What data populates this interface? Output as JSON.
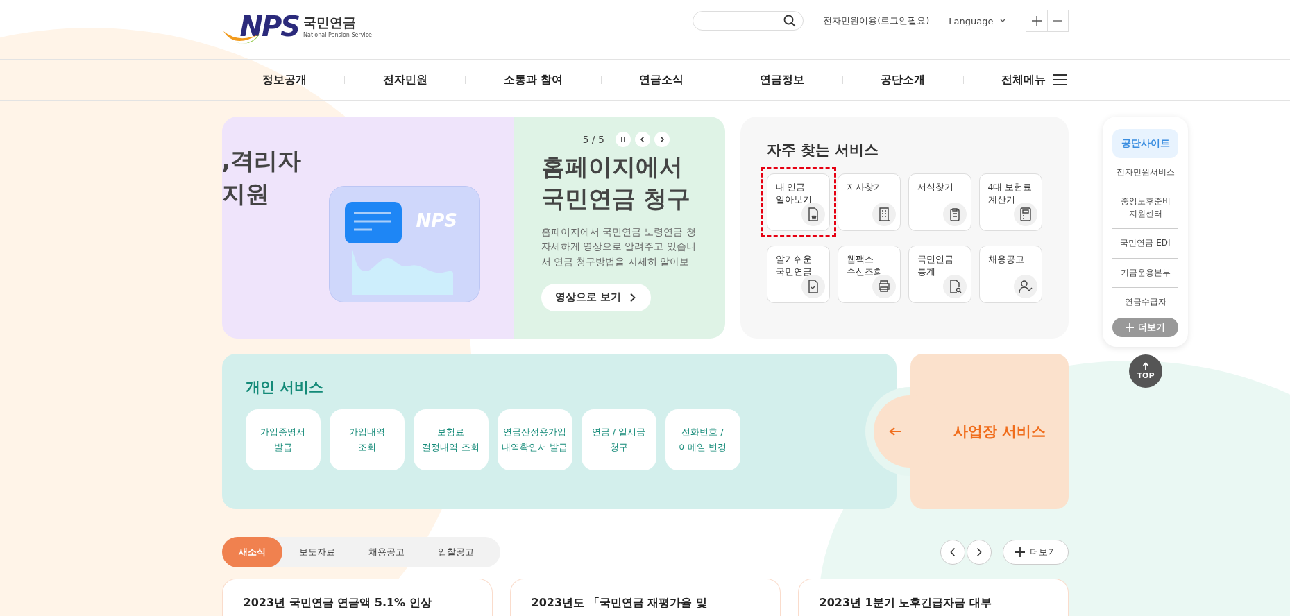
{
  "header": {
    "logo": {
      "mark": "NPS",
      "name": "국민연금",
      "subtitle": "National Pension Service"
    },
    "links": [
      {
        "label": "전자민원이용(로그인필요)",
        "kind": "link"
      },
      {
        "label": "Language",
        "kind": "dropdown"
      }
    ]
  },
  "nav": {
    "items": [
      "정보공개",
      "전자민원",
      "소통과 참여",
      "연금소식",
      "연금정보",
      "공단소개"
    ],
    "all_menu": "전체메뉴"
  },
  "banner": {
    "counter": "5 / 5",
    "playing": true,
    "previous_slide": {
      "heading_lines": [
        ",격리자",
        "지원"
      ],
      "illustration_logo": "NPS"
    },
    "current_slide": {
      "heading_lines": [
        "홈페이지에서",
        "국민연금 청구"
      ],
      "text_lines": [
        "홈페이지에서 국민연금 노령연금 청",
        "자세하게 영상으로 알려주고 있습니",
        "서 연금 청구방법을 자세히 알아보"
      ],
      "button": "영상으로 보기"
    }
  },
  "frequent_services": {
    "title": "자주 찾는 서비스",
    "items": [
      {
        "label_lines": [
          "내 연금",
          "알아보기"
        ],
        "kind": "pension",
        "focused": true
      },
      {
        "label_lines": [
          "지사찾기"
        ],
        "kind": "branch",
        "focused": false
      },
      {
        "label_lines": [
          "서식찾기"
        ],
        "kind": "form",
        "focused": false
      },
      {
        "label_lines": [
          "4대 보험료",
          "계산기"
        ],
        "kind": "calculator",
        "focused": false
      },
      {
        "label_lines": [
          "알기쉬운",
          "국민연금"
        ],
        "kind": "guide",
        "focused": false
      },
      {
        "label_lines": [
          "웹팩스",
          "수신조회"
        ],
        "kind": "fax",
        "focused": false
      },
      {
        "label_lines": [
          "국민연금",
          "통계"
        ],
        "kind": "statistics",
        "focused": false
      },
      {
        "label_lines": [
          "채용공고"
        ],
        "kind": "recruit",
        "focused": false
      }
    ]
  },
  "site_panel": {
    "title": "공단사이트",
    "items": [
      {
        "label_lines": [
          "전자민원서비스"
        ]
      },
      {
        "label_lines": [
          "중앙노후준비",
          "지원센터"
        ]
      },
      {
        "label_lines": [
          "국민연금 EDI"
        ]
      },
      {
        "label_lines": [
          "기금운용본부"
        ]
      },
      {
        "label_lines": [
          "연금수급자"
        ]
      }
    ],
    "more": "더보기",
    "top": "TOP"
  },
  "personal_services": {
    "title": "개인 서비스",
    "items": [
      {
        "label_lines": [
          "가입증명서",
          "발급"
        ]
      },
      {
        "label_lines": [
          "가입내역",
          "조회"
        ]
      },
      {
        "label_lines": [
          "보험료",
          "결정내역 조회"
        ]
      },
      {
        "label_lines": [
          "연금산정용가입",
          "내역확인서 발급"
        ]
      },
      {
        "label_lines": [
          "연금 / 일시금",
          "청구"
        ]
      },
      {
        "label_lines": [
          "전화번호 /",
          "이메일 변경"
        ]
      }
    ]
  },
  "business_service": {
    "label": "사업장 서비스"
  },
  "news": {
    "tabs": [
      {
        "label": "새소식",
        "selected": true
      },
      {
        "label": "보도자료",
        "selected": false
      },
      {
        "label": "채용공고",
        "selected": false
      },
      {
        "label": "입찰공고",
        "selected": false
      }
    ],
    "more": "더보기",
    "cards": [
      {
        "title": "2023년 국민연금 연금액 5.1% 인상"
      },
      {
        "title": "2023년도 「국민연금 재평가율 및"
      },
      {
        "title": "2023년 1분기 노후긴급자금 대부"
      }
    ]
  }
}
